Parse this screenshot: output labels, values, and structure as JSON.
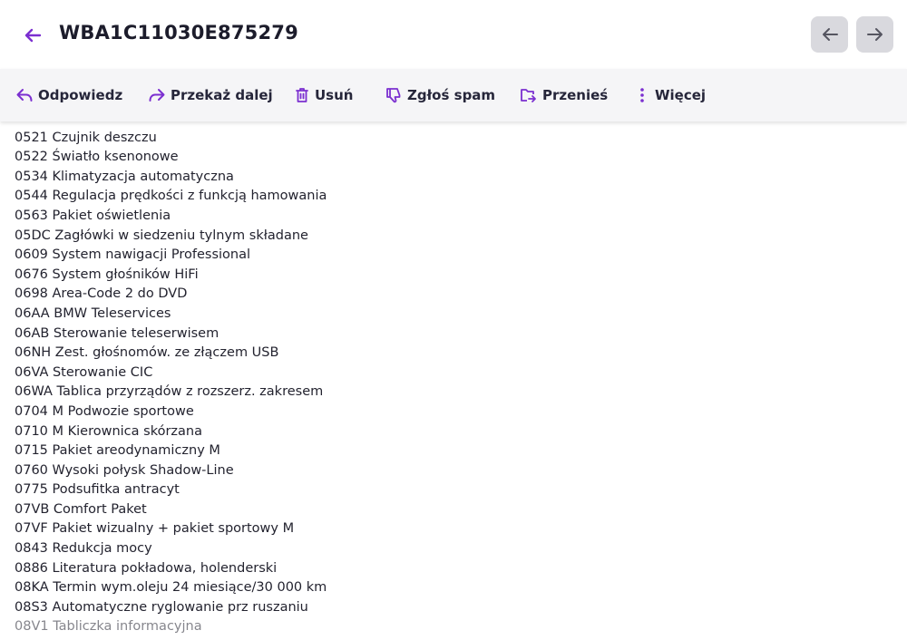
{
  "header": {
    "title": "WBA1C11030E875279",
    "back_icon": "arrow-left-icon",
    "prev_icon": "arrow-left-icon",
    "next_icon": "arrow-right-icon"
  },
  "toolbar": {
    "items": [
      {
        "label": "Odpowiedz",
        "icon": "reply-icon"
      },
      {
        "label": "Przekaż dalej",
        "icon": "forward-icon"
      },
      {
        "label": "Usuń",
        "icon": "trash-icon"
      },
      {
        "label": "Zgłoś spam",
        "icon": "thumbs-down-icon"
      },
      {
        "label": "Przenieś",
        "icon": "move-folder-icon"
      },
      {
        "label": "Więcej",
        "icon": "more-vertical-icon"
      }
    ]
  },
  "colors": {
    "accent": "#7b2fd0",
    "nav_button_bg": "#d9d9de",
    "toolbar_bg": "#f5f5f7",
    "text": "#23232f"
  },
  "body_lines": [
    "0521 Czujnik deszczu",
    "0522 Światło ksenonowe",
    "0534 Klimatyzacja automatyczna",
    "0544 Regulacja prędkości z funkcją hamowania",
    "0563 Pakiet oświetlenia",
    "05DC Zagłówki w siedzeniu tylnym składane",
    "0609 System nawigacji Professional",
    "0676 System głośników HiFi",
    "0698 Area-Code 2 do DVD",
    "06AA BMW Teleservices",
    "06AB Sterowanie teleserwisem",
    "06NH Zest. głośnomów. ze złączem USB",
    "06VA Sterowanie CIC",
    "06WA Tablica przyrządów z rozszerz. zakresem",
    "0704 M Podwozie sportowe",
    "0710 M Kierownica skórzana",
    "0715 Pakiet areodynamiczny M",
    "0760 Wysoki połysk Shadow-Line",
    "0775 Podsufitka antracyt",
    "07VB Comfort Paket",
    "07VF Pakiet wizualny + pakiet sportowy M",
    "0843 Redukcja mocy",
    "0886 Literatura pokładowa, holenderski",
    "08KA Termin wym.oleju 24 miesiące/30 000 km",
    "08S3 Automatyczne ryglowanie prz ruszaniu",
    "08V1 Tabliczka informacyjna"
  ]
}
